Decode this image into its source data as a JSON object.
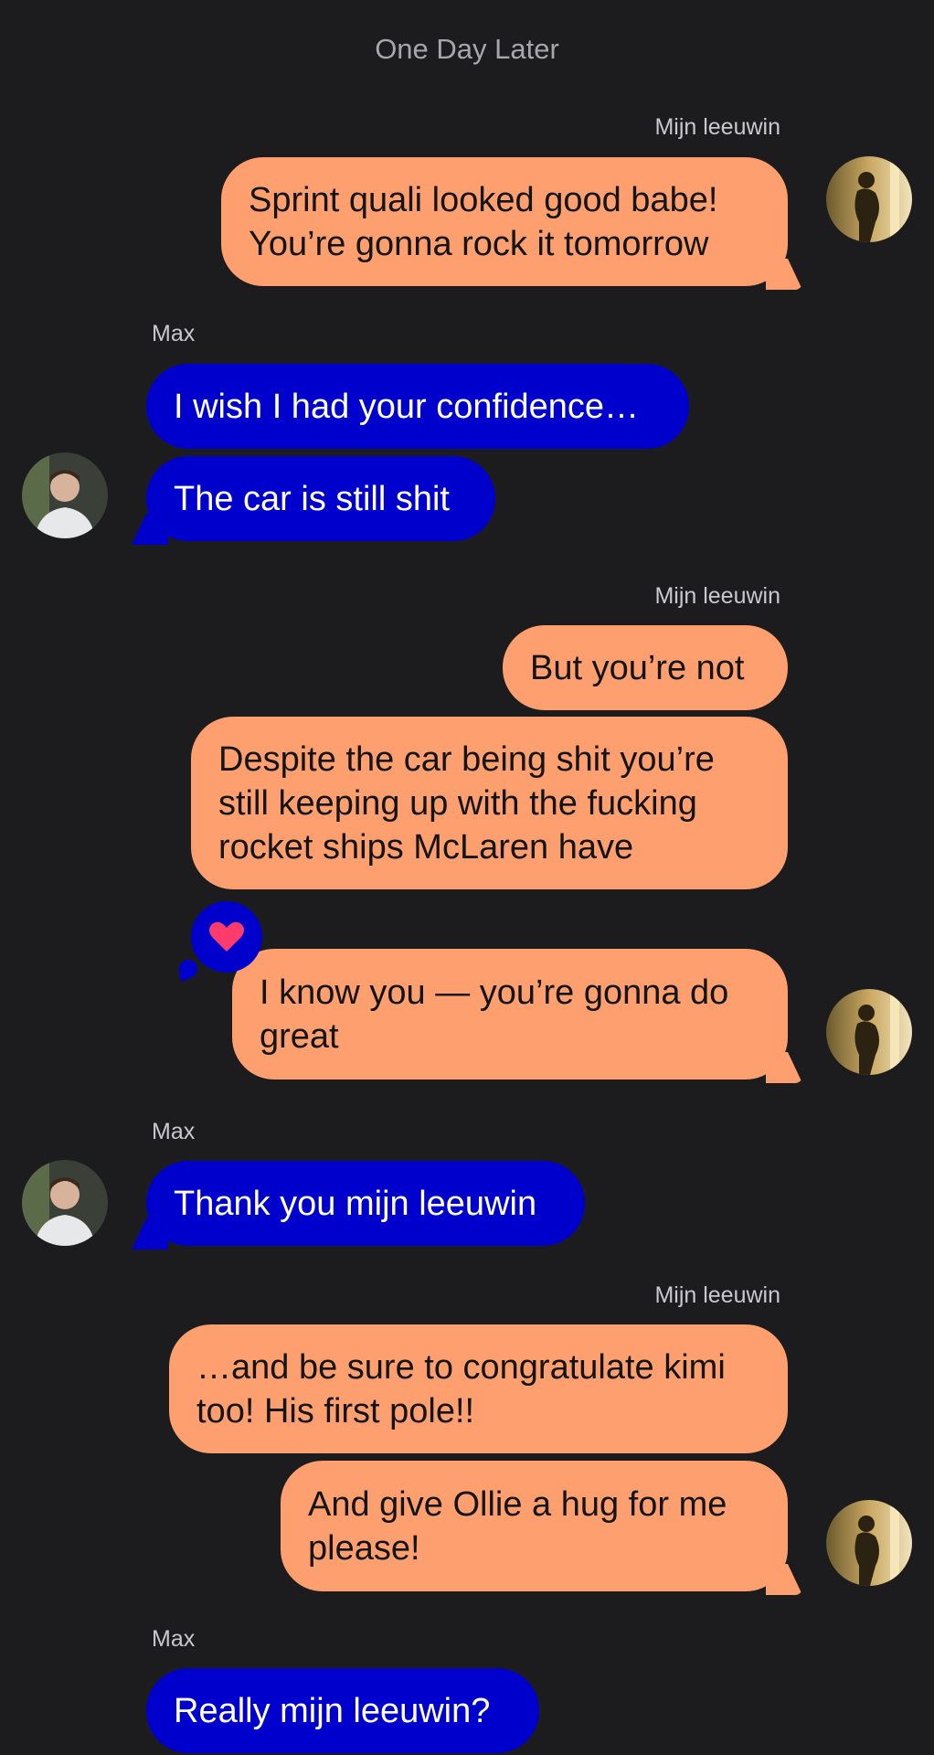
{
  "header": {
    "title": "One Day Later"
  },
  "names": {
    "me": "Mijn leeuwin",
    "them": "Max"
  },
  "messages": [
    "Sprint quali looked good babe!\nYou’re gonna rock it tomorrow",
    "I wish I had your confidence…",
    "The car is still shit",
    "But you’re not",
    "Despite the car being shit you’re\nstill keeping up with the fucking\nrocket ships McLaren have",
    "I know you — you’re gonna do\ngreat",
    "Thank you mijn leeuwin",
    "…and be sure to congratulate kimi\ntoo! His first pole!!",
    "And give Ollie a hug for me\nplease!",
    "Really mijn leeuwin?"
  ],
  "colors": {
    "background": "#1c1c1e",
    "outgoing_bubble": "#fd9f6f",
    "incoming_bubble": "#0000cd",
    "heart": "#ff3b6b"
  },
  "icons": {
    "reaction": "heart-icon",
    "avatar_me": "avatar-silhouette",
    "avatar_them": "avatar-photo"
  }
}
